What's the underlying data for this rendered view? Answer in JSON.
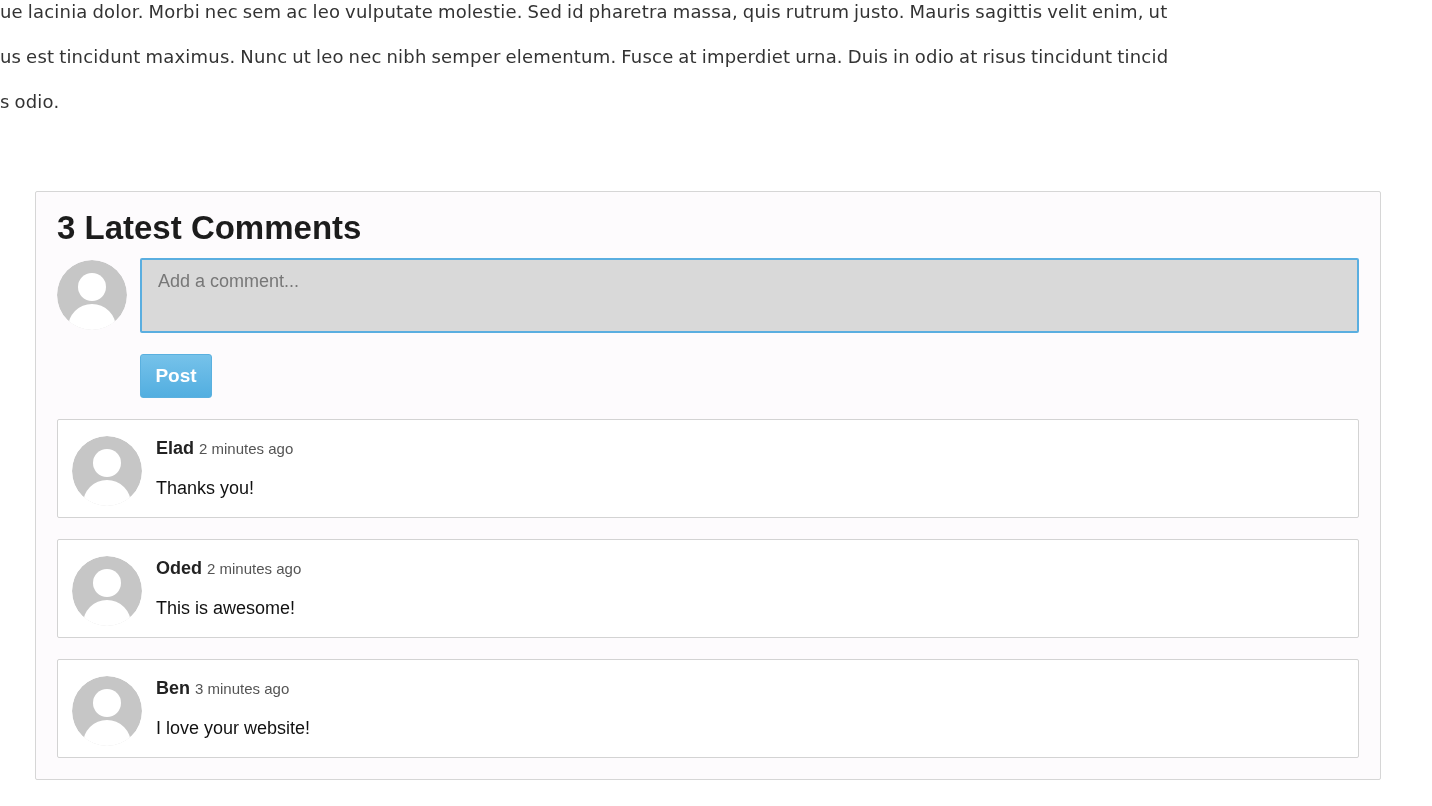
{
  "article": {
    "lines": [
      "ue lacinia dolor. Morbi nec sem ac leo vulputate molestie. Sed id pharetra massa, quis rutrum justo. Mauris sagittis velit enim, ut",
      "us est tincidunt maximus. Nunc ut leo nec nibh semper elementum. Fusce at imperdiet urna. Duis in odio at risus tincidunt tincid",
      "s odio."
    ]
  },
  "comments_panel": {
    "title": "3 Latest Comments",
    "comment_field": {
      "placeholder": "Add a comment..."
    },
    "post_button": "Post",
    "comments": [
      {
        "author": "Elad",
        "time": "2 minutes ago",
        "text": "Thanks you!"
      },
      {
        "author": "Oded",
        "time": "2 minutes ago",
        "text": "This is awesome!"
      },
      {
        "author": "Ben",
        "time": "3 minutes ago",
        "text": "I love your website!"
      }
    ]
  }
}
